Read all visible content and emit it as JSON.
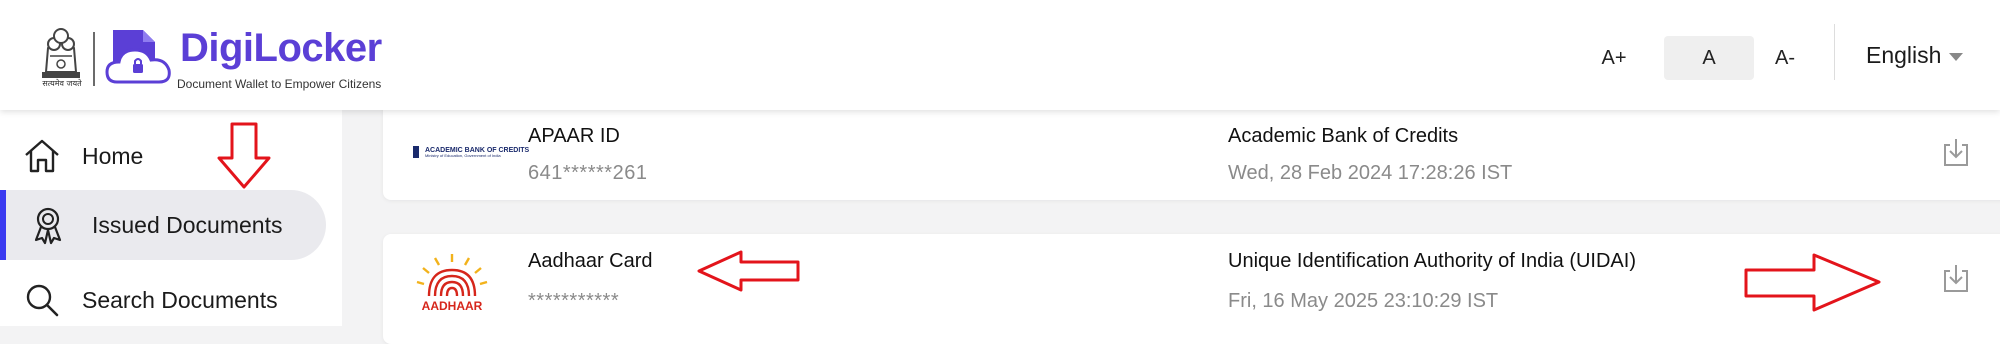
{
  "header": {
    "emblem_caption": "सत्यमेव जयते",
    "brand_name": "DigiLocker",
    "brand_tagline": "Document Wallet to Empower Citizens",
    "font_controls": [
      "A+",
      "A",
      "A-"
    ],
    "language": "English"
  },
  "sidebar": {
    "items": [
      {
        "label": "Home",
        "icon": "home-icon"
      },
      {
        "label": "Issued Documents",
        "icon": "award-ribbon-icon",
        "active": true
      },
      {
        "label": "Search Documents",
        "icon": "search-icon"
      }
    ]
  },
  "documents": [
    {
      "logo_text": "ACADEMIC BANK OF CREDITS",
      "logo_subtext": "Ministry of Education, Government of India",
      "title": "APAAR ID",
      "number": "641******261",
      "issuer": "Academic Bank of Credits",
      "date": "Wed, 28 Feb 2024 17:28:26 IST"
    },
    {
      "logo_text": "AADHAAR",
      "title": "Aadhaar Card",
      "number": "***********",
      "issuer": "Unique Identification Authority of India (UIDAI)",
      "date": "Fri, 16 May 2025 23:10:29 IST"
    }
  ],
  "colors": {
    "brand": "#5b3fd6",
    "active_indicator": "#3a3af0",
    "annotation": "#e3141b",
    "aadhaar_red": "#d6261b",
    "aadhaar_yellow": "#f2b21b"
  }
}
